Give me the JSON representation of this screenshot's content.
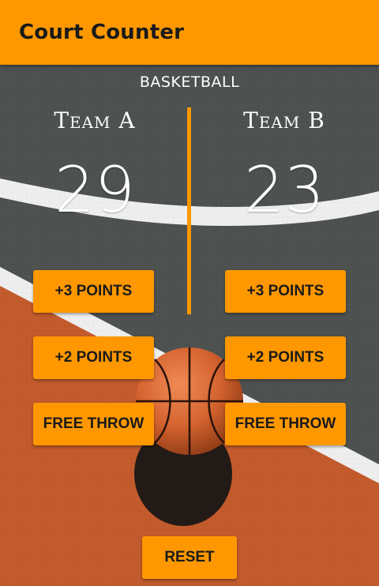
{
  "app_bar": {
    "title": "Court Counter"
  },
  "sport": "BASKETBALL",
  "team_a": {
    "name": "Team A",
    "score": "29",
    "buttons": {
      "three": "+3 POINTS",
      "two": "+2 POINTS",
      "free": "FREE THROW"
    }
  },
  "team_b": {
    "name": "Team B",
    "score": "23",
    "buttons": {
      "three": "+3 POINTS",
      "two": "+2 POINTS",
      "free": "FREE THROW"
    }
  },
  "reset_label": "RESET",
  "colors": {
    "accent": "#FF9800",
    "court_gray": "#4e5250",
    "court_orange": "#c25a2c",
    "line_white": "#f2f2f2"
  },
  "icons": {
    "background": "basketball-court-background",
    "ball": "basketball-icon"
  }
}
